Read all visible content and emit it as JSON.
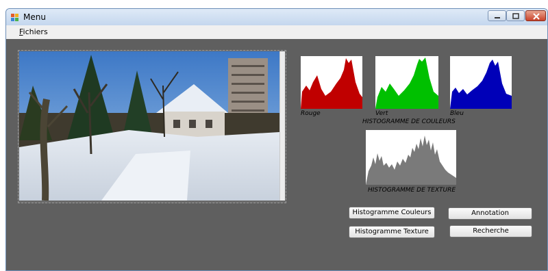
{
  "window": {
    "title": "Menu",
    "icon": "app-icon",
    "controls": {
      "minimize": "minimize-icon",
      "maximize": "maximize-icon",
      "close": "close-icon"
    }
  },
  "menubar": {
    "items": [
      {
        "mnemonic": "F",
        "rest": "ichiers"
      }
    ]
  },
  "picture": {
    "content": "snowy house landscape photo"
  },
  "histograms": {
    "red_label": "Rouge",
    "green_label": "Vert",
    "blue_label": "Bleu",
    "colors_title": "HISTOGRAMME DE COULEURS",
    "texture_title": "HISTOGRAMME DE TEXTURE",
    "colors": {
      "red": "#c00000",
      "green": "#00c000",
      "blue": "#0000b8",
      "texture": "#7a7a7a"
    }
  },
  "buttons": {
    "hist_colors": "Histogramme Couleurs",
    "hist_texture": "Histogramme Texture",
    "annotation": "Annotation",
    "search": "Recherche"
  }
}
